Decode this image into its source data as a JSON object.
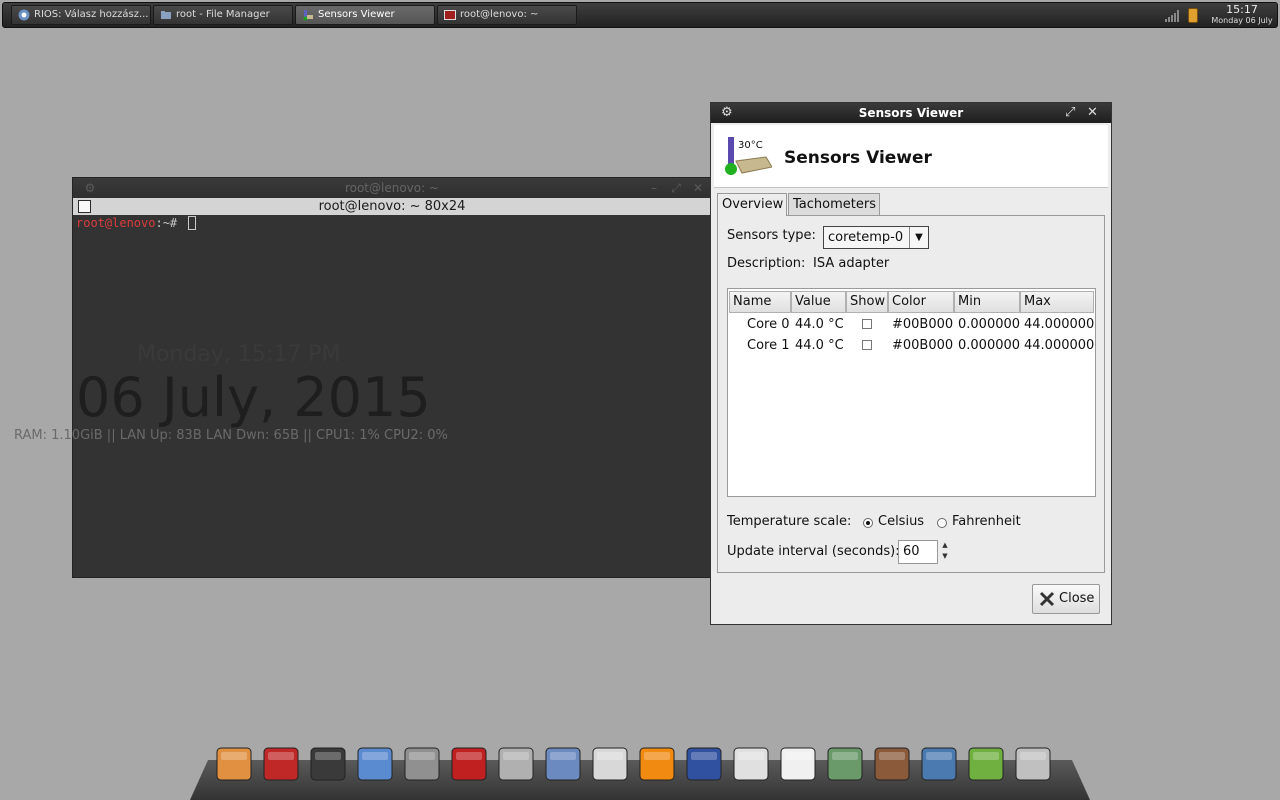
{
  "taskbar": {
    "tasks": [
      {
        "label": "RIOS: Válasz hozzász..."
      },
      {
        "label": "root - File Manager"
      },
      {
        "label": "Sensors Viewer"
      },
      {
        "label": "root@lenovo: ~"
      }
    ],
    "clock_time": "15:17",
    "clock_date": "Monday 06 July"
  },
  "conky": {
    "day_line": "Monday, 15:17 PM",
    "date_line": "06 July, 2015",
    "stats_line": "RAM: 1.10GiB || LAN Up: 83B   LAN Dwn: 65B   || CPU1: 1% CPU2: 0%"
  },
  "terminal": {
    "title": "root@lenovo: ~",
    "menubar_title": "root@lenovo: ~ 80x24",
    "prompt_user": "root@lenovo",
    "prompt_rest": ":~# "
  },
  "sensors_viewer": {
    "title": "Sensors Viewer",
    "heading": "Sensors Viewer",
    "icon_temp_label": "30°C",
    "tabs": [
      {
        "label": "Overview",
        "active": true
      },
      {
        "label": "Tachometers",
        "active": false
      }
    ],
    "sensors_type_label": "Sensors type:",
    "sensors_type_value": "coretemp-0",
    "description_label": "Description:",
    "description_value": "ISA adapter",
    "columns": [
      "Name",
      "Value",
      "Show",
      "Color",
      "Min",
      "Max"
    ],
    "rows": [
      {
        "name": "Core 0",
        "value": "44.0 °C",
        "show": false,
        "color": "#00B000",
        "min": "0.000000",
        "max": "44.000000"
      },
      {
        "name": "Core 1",
        "value": "44.0 °C",
        "show": false,
        "color": "#00B000",
        "min": "0.000000",
        "max": "44.000000"
      }
    ],
    "temperature_scale_label": "Temperature scale:",
    "celsius_label": "Celsius",
    "fahrenheit_label": "Fahrenheit",
    "selected_scale": "Celsius",
    "update_interval_label": "Update interval (seconds):",
    "update_interval_value": "60",
    "close_label": "Close"
  },
  "dock": {
    "icons": [
      "anchor-icon",
      "task-manager-icon",
      "terminal-icon",
      "chromium-icon",
      "devices-icon",
      "filezilla-icon",
      "screenshot-icon",
      "search-icon",
      "install-icon",
      "vlc-icon",
      "media-player-icon",
      "disk-icon",
      "package-icon",
      "network-tools-icon",
      "library-icon",
      "remote-desktop-icon",
      "text-editor-icon",
      "trash-icon"
    ]
  }
}
